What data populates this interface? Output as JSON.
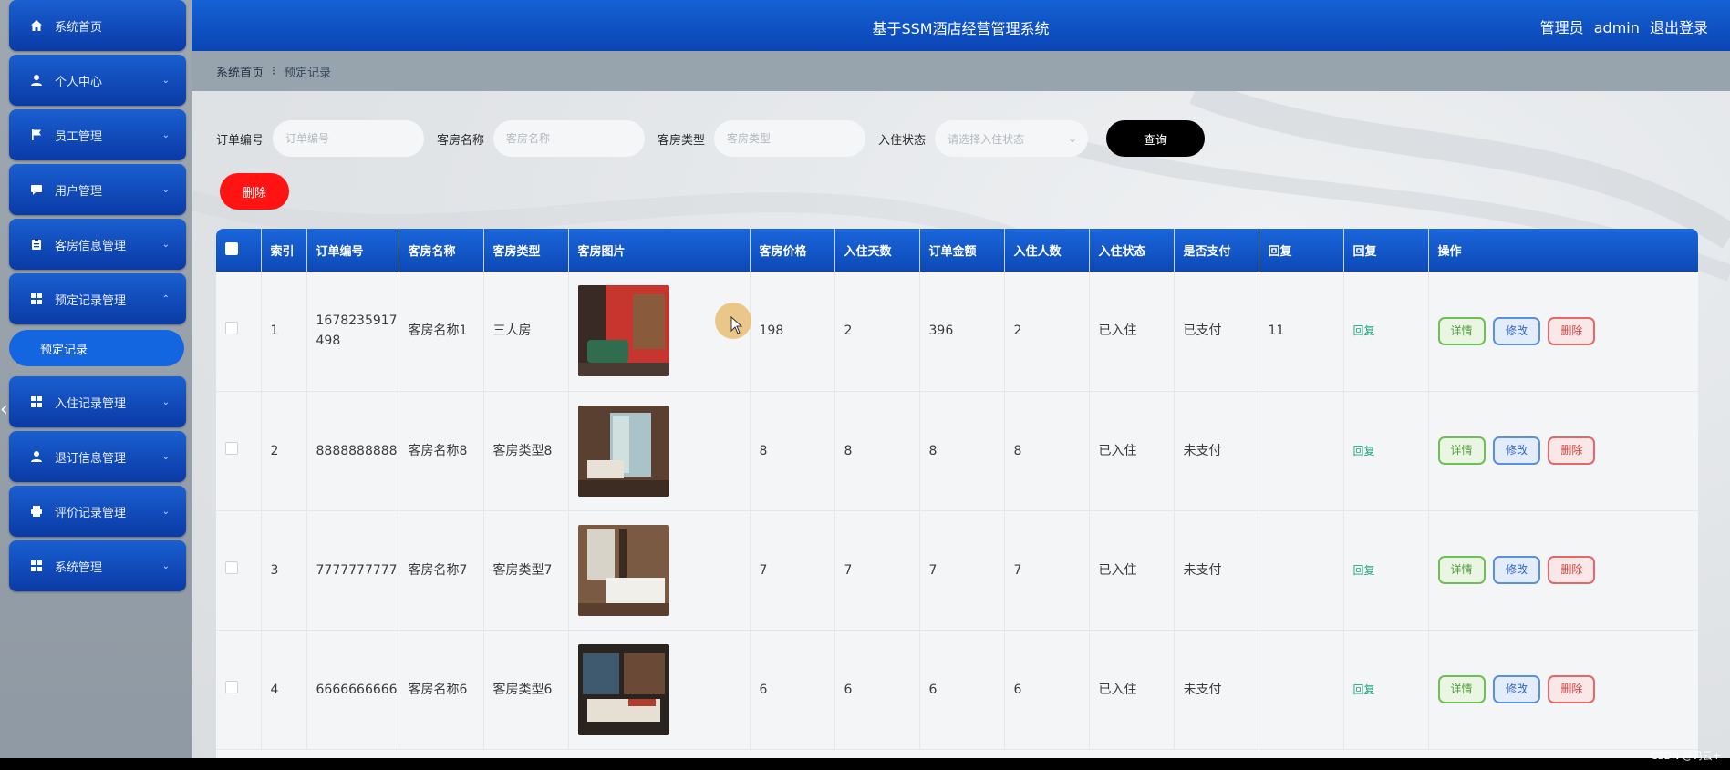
{
  "app": {
    "title": "基于SSM酒店经营管理系统"
  },
  "header": {
    "role": "管理员",
    "username": "admin",
    "logout": "退出登录"
  },
  "sidebar": {
    "items": [
      {
        "label": "系统首页",
        "icon": "home-icon",
        "chevron": ""
      },
      {
        "label": "个人中心",
        "icon": "user-icon",
        "chevron": "⌄"
      },
      {
        "label": "员工管理",
        "icon": "flag-icon",
        "chevron": "⌄"
      },
      {
        "label": "用户管理",
        "icon": "message-icon",
        "chevron": "⌄"
      },
      {
        "label": "客房信息管理",
        "icon": "clipboard-icon",
        "chevron": "⌄"
      },
      {
        "label": "预定记录管理",
        "icon": "grid-icon",
        "chevron": "⌃"
      },
      {
        "label": "入住记录管理",
        "icon": "grid-icon",
        "chevron": "⌄"
      },
      {
        "label": "退订信息管理",
        "icon": "user-icon",
        "chevron": "⌄"
      },
      {
        "label": "评价记录管理",
        "icon": "printer-icon",
        "chevron": "⌄"
      },
      {
        "label": "系统管理",
        "icon": "grid-icon",
        "chevron": "⌄"
      }
    ],
    "submenu": {
      "label": "预定记录"
    }
  },
  "breadcrumb": {
    "home": "系统首页",
    "separator": "⁝",
    "current": "预定记录"
  },
  "search": {
    "order_no": {
      "label": "订单编号",
      "placeholder": "订单编号"
    },
    "room_name": {
      "label": "客房名称",
      "placeholder": "客房名称"
    },
    "room_type": {
      "label": "客房类型",
      "placeholder": "客房类型"
    },
    "checkin_status": {
      "label": "入住状态",
      "placeholder": "请选择入住状态"
    },
    "submit": "查询"
  },
  "actions": {
    "delete": "删除"
  },
  "table": {
    "headers": [
      "",
      "索引",
      "订单编号",
      "客房名称",
      "客房类型",
      "客房图片",
      "客房价格",
      "入住天数",
      "订单金额",
      "入住人数",
      "入住状态",
      "是否支付",
      "回复",
      "回复",
      "操作"
    ],
    "rows": [
      {
        "index": "1",
        "order_no": "1678235917498",
        "room_name": "客房名称1",
        "room_type": "三人房",
        "price": "198",
        "days": "2",
        "amount": "396",
        "people": "2",
        "status": "已入住",
        "paid": "已支付",
        "reply": "11",
        "reply_link": "回复",
        "photo": "photo-room-red"
      },
      {
        "index": "2",
        "order_no": "8888888888",
        "room_name": "客房名称8",
        "room_type": "客房类型8",
        "price": "8",
        "days": "8",
        "amount": "8",
        "people": "8",
        "status": "已入住",
        "paid": "未支付",
        "reply": "",
        "reply_link": "回复",
        "photo": "photo-room-balcony"
      },
      {
        "index": "3",
        "order_no": "7777777777",
        "room_name": "客房名称7",
        "room_type": "客房类型7",
        "price": "7",
        "days": "7",
        "amount": "7",
        "people": "7",
        "status": "已入住",
        "paid": "未支付",
        "reply": "",
        "reply_link": "回复",
        "photo": "photo-room-bed"
      },
      {
        "index": "4",
        "order_no": "6666666666",
        "room_name": "客房名称6",
        "room_type": "客房类型6",
        "price": "6",
        "days": "6",
        "amount": "6",
        "people": "6",
        "status": "已入住",
        "paid": "未支付",
        "reply": "",
        "reply_link": "回复",
        "photo": "photo-room-dark"
      }
    ],
    "ops": {
      "detail": "详情",
      "edit": "修改",
      "delete": "删除"
    }
  },
  "colors": {
    "primary": "#0d49b6",
    "danger": "#ff1313",
    "success": "#4f9f3a"
  },
  "watermark": "CSDN @码云+"
}
